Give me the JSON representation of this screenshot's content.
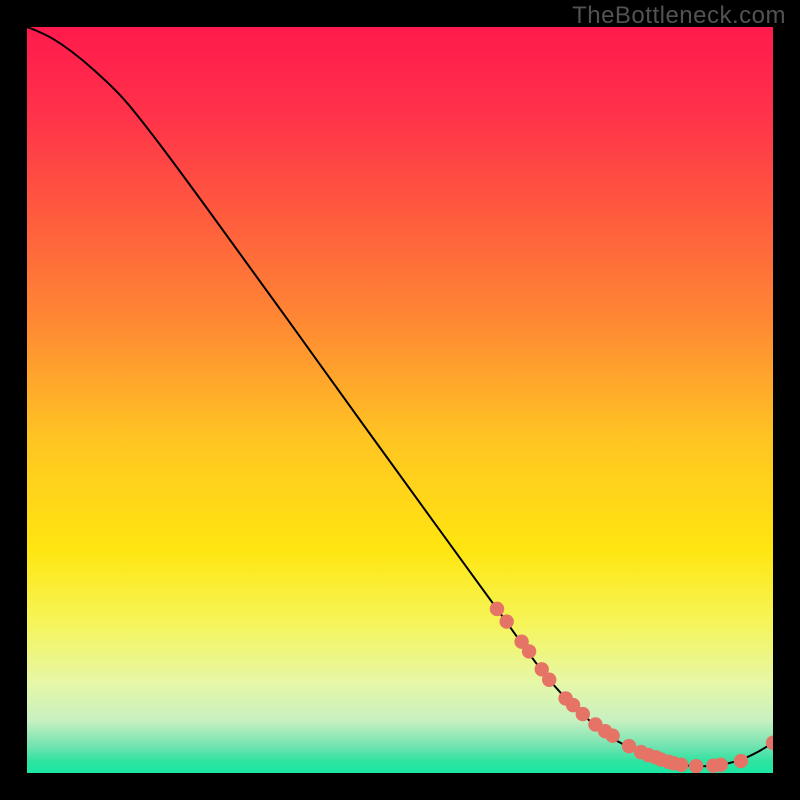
{
  "watermark": "TheBottleneck.com",
  "chart_data": {
    "type": "line",
    "title": "",
    "xlabel": "",
    "ylabel": "",
    "xlim": [
      0,
      100
    ],
    "ylim": [
      0,
      100
    ],
    "grid": false,
    "legend": false,
    "gradient_stops": [
      {
        "offset": 0.0,
        "color": "#ff1a4d"
      },
      {
        "offset": 0.12,
        "color": "#ff334a"
      },
      {
        "offset": 0.25,
        "color": "#ff5a3e"
      },
      {
        "offset": 0.4,
        "color": "#ff8a33"
      },
      {
        "offset": 0.55,
        "color": "#ffc423"
      },
      {
        "offset": 0.7,
        "color": "#ffe610"
      },
      {
        "offset": 0.8,
        "color": "#f5f55a"
      },
      {
        "offset": 0.88,
        "color": "#e6f7a8"
      },
      {
        "offset": 0.93,
        "color": "#c7f0c0"
      },
      {
        "offset": 0.965,
        "color": "#6fe3b0"
      },
      {
        "offset": 0.985,
        "color": "#2de3a0"
      },
      {
        "offset": 1.0,
        "color": "#1be8a4"
      }
    ],
    "series": [
      {
        "name": "curve",
        "x": [
          0.0,
          1.5,
          3.5,
          6.0,
          9.0,
          13.0,
          18.0,
          25.0,
          35.0,
          45.0,
          55.0,
          63.0,
          70.0,
          76.0,
          80.0,
          83.5,
          86.0,
          88.0,
          90.0,
          92.0,
          94.0,
          96.0,
          98.0,
          100.0
        ],
        "y": [
          100.0,
          99.4,
          98.4,
          96.7,
          94.2,
          90.3,
          84.0,
          74.5,
          60.7,
          46.8,
          33.0,
          22.0,
          12.5,
          6.5,
          3.8,
          2.3,
          1.45,
          1.05,
          0.9,
          0.98,
          1.3,
          1.9,
          2.85,
          4.05
        ]
      },
      {
        "name": "markers",
        "x": [
          63.0,
          64.3,
          66.3,
          67.3,
          69.0,
          70.0,
          72.2,
          73.2,
          74.5,
          76.2,
          77.5,
          78.5,
          80.7,
          82.3,
          83.3,
          84.3,
          85.0,
          86.0,
          86.7,
          87.7,
          89.7,
          92.0,
          93.0,
          95.7,
          100.0
        ],
        "y": [
          22.0,
          20.3,
          17.6,
          16.3,
          13.9,
          12.5,
          10.0,
          9.1,
          7.9,
          6.5,
          5.6,
          5.0,
          3.6,
          2.8,
          2.4,
          2.1,
          1.8,
          1.5,
          1.3,
          1.1,
          0.92,
          0.98,
          1.1,
          1.6,
          4.05
        ]
      }
    ]
  }
}
